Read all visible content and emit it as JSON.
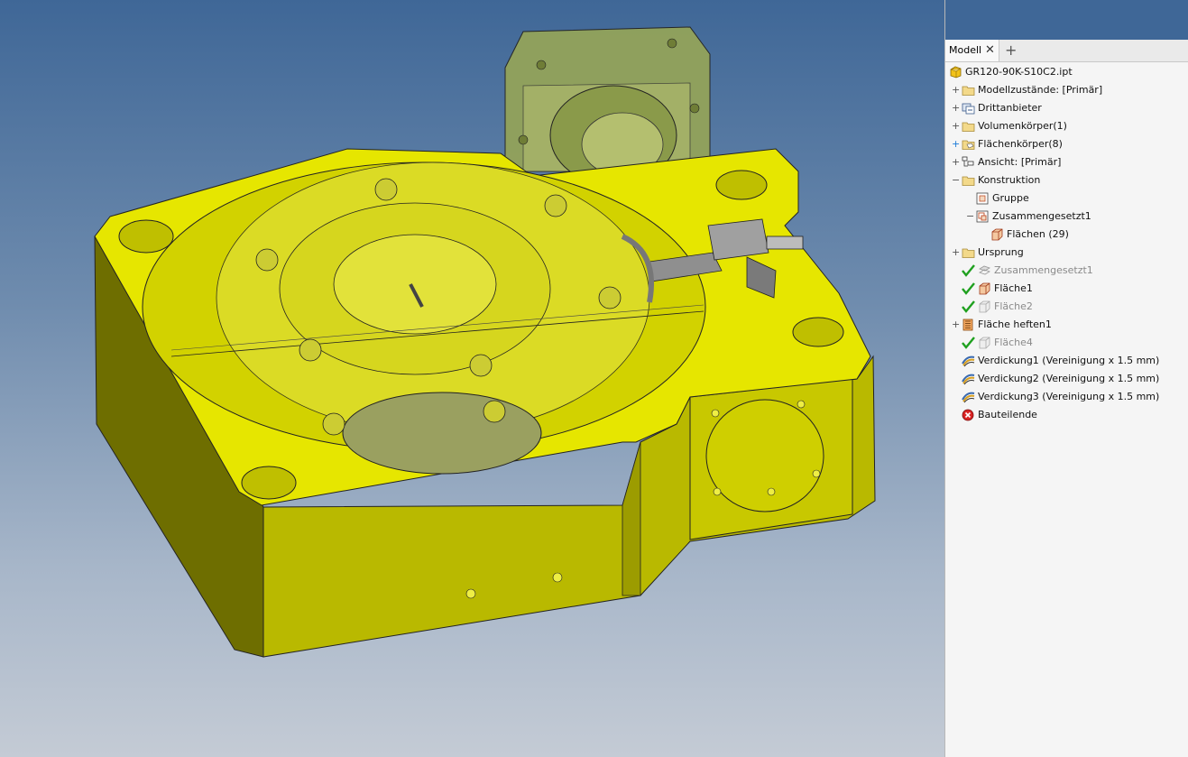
{
  "panel": {
    "tab_label": "Modell",
    "tab_close": "✕",
    "tab_add": "+",
    "tree": [
      {
        "label": "GR120-90K-S10C2.ipt",
        "icon": "part-icon",
        "indent": 0,
        "expander": "",
        "check": false,
        "dim": false
      },
      {
        "label": "Modellzustände: [Primär]",
        "icon": "folder-icon",
        "indent": 1,
        "expander": "+",
        "check": false,
        "dim": false
      },
      {
        "label": "Drittanbieter",
        "icon": "third-party-icon",
        "indent": 1,
        "expander": "+",
        "check": false,
        "dim": false
      },
      {
        "label": "Volumenkörper(1)",
        "icon": "folder-icon",
        "indent": 1,
        "expander": "+",
        "check": false,
        "dim": false
      },
      {
        "label": "Flächenkörper(8)",
        "icon": "surface-bodies-icon",
        "indent": 1,
        "expander": "+",
        "check": false,
        "dim": false,
        "blue_expander": true
      },
      {
        "label": "Ansicht: [Primär]",
        "icon": "view-icon",
        "indent": 1,
        "expander": "+",
        "check": false,
        "dim": false
      },
      {
        "label": "Konstruktion",
        "icon": "folder-icon",
        "indent": 1,
        "expander": "−",
        "check": false,
        "dim": false
      },
      {
        "label": "Gruppe",
        "icon": "group-icon",
        "indent": 2,
        "expander": "",
        "check": false,
        "dim": false
      },
      {
        "label": "Zusammengesetzt1",
        "icon": "composite-icon",
        "indent": 2,
        "expander": "−",
        "check": false,
        "dim": false
      },
      {
        "label": "Flächen (29)",
        "icon": "surface-icon",
        "indent": 3,
        "expander": "",
        "check": false,
        "dim": false
      },
      {
        "label": "Ursprung",
        "icon": "folder-icon",
        "indent": 1,
        "expander": "+",
        "check": false,
        "dim": false
      },
      {
        "label": "Zusammengesetzt1",
        "icon": "composite-gray-icon",
        "indent": 1,
        "expander": "",
        "check": true,
        "dim": true
      },
      {
        "label": "Fläche1",
        "icon": "surface-icon",
        "indent": 1,
        "expander": "",
        "check": true,
        "dim": false
      },
      {
        "label": "Fläche2",
        "icon": "surface-gray-icon",
        "indent": 1,
        "expander": "",
        "check": true,
        "dim": true
      },
      {
        "label": "Fläche heften1",
        "icon": "stitch-icon",
        "indent": 1,
        "expander": "+",
        "check": false,
        "dim": false
      },
      {
        "label": "Fläche4",
        "icon": "surface-gray-icon",
        "indent": 1,
        "expander": "",
        "check": true,
        "dim": true
      },
      {
        "label": "Verdickung1 (Vereinigung x 1.5 mm)",
        "icon": "thicken-icon",
        "indent": 1,
        "expander": "",
        "check": false,
        "dim": false
      },
      {
        "label": "Verdickung2 (Vereinigung x 1.5 mm)",
        "icon": "thicken-icon",
        "indent": 1,
        "expander": "",
        "check": false,
        "dim": false
      },
      {
        "label": "Verdickung3 (Vereinigung x 1.5 mm)",
        "icon": "thicken-icon",
        "indent": 1,
        "expander": "",
        "check": false,
        "dim": false
      },
      {
        "label": "Bauteilende",
        "icon": "end-of-part-icon",
        "indent": 1,
        "expander": "",
        "check": false,
        "dim": false
      }
    ]
  },
  "colors": {
    "body_top": "#e8e800",
    "body_front": "#c2c200",
    "body_side": "#a8a800",
    "body_dark": "#6a6a00",
    "shell": "#9aa84a",
    "check": "#1fa01f",
    "error": "#d92424"
  }
}
